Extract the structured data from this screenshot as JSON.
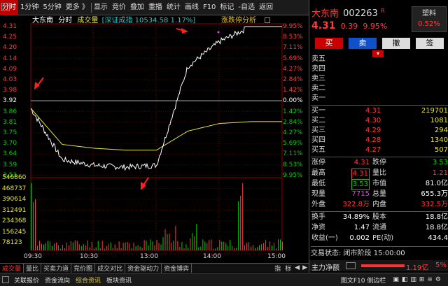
{
  "toolbar": {
    "items": [
      "分时",
      "1分钟",
      "5分钟",
      "更多 》",
      "显示",
      "竞价",
      "叠加",
      "重播",
      "统计",
      "画线",
      "F10",
      "标记",
      "-自选",
      "返回"
    ],
    "active": 0
  },
  "chart_header": {
    "name": "大东南",
    "mode": "分时",
    "volume_label": "成交量",
    "index_info": "[深证成指 10534.58 1.17%]",
    "limit_analysis": "涨跌停分析"
  },
  "y_left": [
    "4.31",
    "4.25",
    "4.20",
    "4.14",
    "4.09",
    "4.03",
    "3.98",
    "3.92",
    "3.86",
    "3.81",
    "3.75",
    "3.70",
    "3.64",
    "3.59",
    "3.53"
  ],
  "y_right": [
    "9.95%",
    "8.53%",
    "7.11%",
    "5.69%",
    "4.27%",
    "2.84%",
    "1.42%",
    "0.00%",
    "1.42%",
    "2.84%",
    "4.27%",
    "5.69%",
    "7.11%",
    "8.53%",
    "9.95%"
  ],
  "vol_axis": [
    "546860",
    "468737",
    "390614",
    "312491",
    "234368",
    "156245",
    "78123"
  ],
  "x_times": [
    "09:30",
    "10:30",
    "13:00",
    "14:00",
    "15:00"
  ],
  "chart_data": {
    "type": "line",
    "title": "大东南 分时",
    "x": [
      "09:30",
      "10:00",
      "10:30",
      "11:00",
      "11:30/13:00",
      "13:30",
      "14:00",
      "14:30",
      "15:00"
    ],
    "series": [
      {
        "name": "price",
        "values": [
          3.88,
          3.61,
          3.58,
          3.57,
          3.58,
          4.1,
          4.23,
          4.31,
          4.31
        ]
      },
      {
        "name": "avg",
        "values": [
          3.88,
          3.69,
          3.67,
          3.66,
          3.66,
          3.76,
          3.8,
          3.81,
          3.81
        ]
      }
    ],
    "ylim": [
      3.53,
      4.31
    ],
    "prev_close": 3.92,
    "volume_max": 546860
  },
  "bottom_tabs": [
    "成交量",
    "量比",
    "买卖力道",
    "竞价图",
    "成交对比",
    "资金驱动力",
    "资金博弈"
  ],
  "bottom_tab_active": 0,
  "bottom_right": [
    "指",
    "标"
  ],
  "status_bar": {
    "items": [
      "关联报价",
      "资金流向",
      "综合资讯",
      "板块资讯"
    ],
    "right": "图文F10 侧边栏"
  },
  "stock": {
    "name": "大东南",
    "code": "002263",
    "badge": "R",
    "price": "4.31",
    "change": "0.39",
    "pct": "9.95%",
    "tag": "塑料",
    "tag_pct": "0.52%"
  },
  "trade_buttons": [
    "买",
    "卖",
    "撤",
    "签"
  ],
  "sell_labels": [
    "卖五",
    "卖四",
    "卖三",
    "卖二",
    "卖一"
  ],
  "buy": [
    {
      "label": "买一",
      "price": "4.31",
      "vol": "219701"
    },
    {
      "label": "买二",
      "price": "4.30",
      "vol": "1081"
    },
    {
      "label": "买三",
      "price": "4.29",
      "vol": "294"
    },
    {
      "label": "买四",
      "price": "4.28",
      "vol": "1340"
    },
    {
      "label": "买五",
      "price": "4.27",
      "vol": "507"
    }
  ],
  "stats": [
    {
      "l1": "涨停",
      "v1": "4.31",
      "l2": "跌停",
      "v2": "3.53"
    },
    {
      "l1": "最高",
      "v1": "4.31",
      "l2": "量比",
      "v2": "1.21"
    },
    {
      "l1": "最低",
      "v1": "3.53",
      "l2": "市值",
      "v2": "81.0亿"
    },
    {
      "l1": "现量",
      "v1": "7715",
      "l2": "总量",
      "v2": "655.3万"
    },
    {
      "l1": "外盘",
      "v1": "322.8万",
      "l2": "内盘",
      "v2": "332.5万"
    }
  ],
  "stats2": [
    {
      "l1": "换手",
      "v1": "34.89%",
      "l2": "股本",
      "v2": "18.8亿"
    },
    {
      "l1": "净资",
      "v1": "1.47",
      "l2": "流通",
      "v2": "18.8亿"
    },
    {
      "l1": "收益(一)",
      "v1": "0.002",
      "l2": "PE(动)",
      "v2": "434.4"
    }
  ],
  "trade_status": "交易状态: 闭市阶段 15:00:00",
  "main_net": {
    "label": "主力净额",
    "value": "1.19亿",
    "pct": "5%"
  },
  "colors": {
    "up": "#ff3c3c",
    "down": "#00d000",
    "price_line": "#ffffff",
    "avg_line": "#e6e63c",
    "prev_close_line": "#30c8c8"
  }
}
